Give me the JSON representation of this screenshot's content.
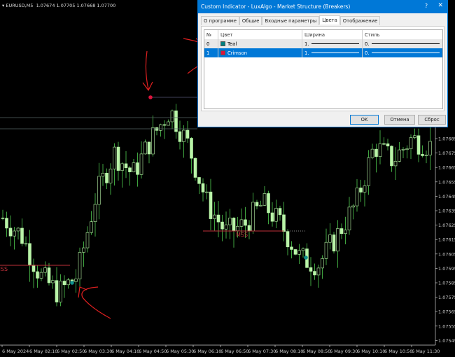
{
  "chart_header": {
    "symbol": "EURUSD,M5",
    "ohlc": "1.07674 1.07705 1.07668 1.07700"
  },
  "chart_data": {
    "type": "candlestick",
    "price_ticks": [
      "1.07685",
      "1.07675",
      "1.07665",
      "1.07655",
      "1.07645",
      "1.07635",
      "1.07625",
      "1.07615",
      "1.07605",
      "1.07595",
      "1.07585",
      "1.07575",
      "1.07565",
      "1.07555",
      "1.07545"
    ],
    "time_ticks": [
      "6 May 2024",
      "6 May 02:10",
      "6 May 02:50",
      "6 May 03:30",
      "6 May 04:10",
      "6 May 04:50",
      "6 May 05:30",
      "6 May 06:10",
      "6 May 06:50",
      "6 May 07:30",
      "6 May 08:10",
      "6 May 08:50",
      "6 May 09:30",
      "6 May 10:10",
      "6 May 10:50",
      "6 May 11:30"
    ],
    "price_path_keypoints": [
      1.0763,
      1.07618,
      1.0759,
      1.07578,
      1.0759,
      1.07645,
      1.07675,
      1.0766,
      1.07685,
      1.07705,
      1.0768,
      1.0764,
      1.0762,
      1.07625,
      1.0764,
      1.07625,
      1.07602,
      1.07598,
      1.07618,
      1.0764,
      1.0768,
      1.0767,
      1.07685,
      1.0768
    ],
    "mss_labels": [
      "MSS",
      "MSS"
    ],
    "colors": {
      "candle": "#b9f5a8",
      "wick": "#3fa33f",
      "mss": "#c0303a",
      "teal": "#10908e",
      "crimson": "#dc143c"
    }
  },
  "dialog": {
    "title": "Custom Indicator - LuxAlgo - Market Structure (Breakers)",
    "help": "?",
    "close": "✕",
    "tabs": [
      "О программе",
      "Общие",
      "Входные параметры",
      "Цвета",
      "Отображение"
    ],
    "columns": [
      "№",
      "Цвет",
      "Ширина",
      "Стиль"
    ],
    "rows": [
      {
        "n": "0",
        "color": "Teal",
        "hex": "#008080",
        "width": "1.",
        "style": "0."
      },
      {
        "n": "1",
        "color": "Crimson",
        "hex": "#dc143c",
        "width": "1.",
        "style": "0."
      }
    ],
    "ok": "OK",
    "cancel": "Отмена",
    "reset": "Сброс"
  }
}
